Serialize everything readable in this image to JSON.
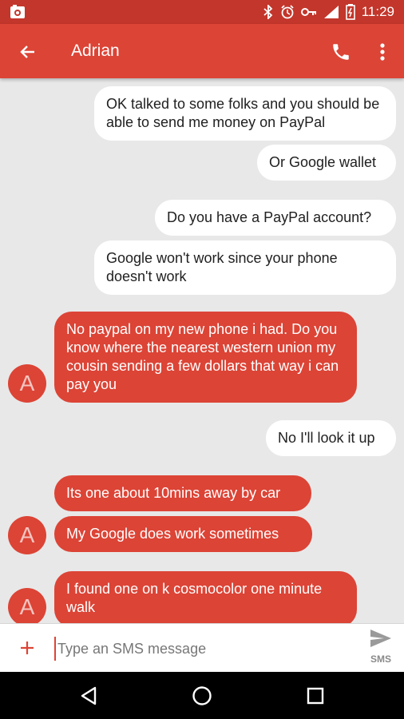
{
  "status_bar": {
    "time": "11:29",
    "icons": [
      "bluetooth-icon",
      "alarm-icon",
      "key-icon",
      "signal-icon",
      "battery-icon"
    ]
  },
  "app_bar": {
    "title": "Adrian",
    "icons": [
      "back-arrow-icon",
      "phone-icon",
      "more-vert-icon"
    ]
  },
  "conversation": {
    "avatar_initial": "A",
    "messages": [
      {
        "dir": "out",
        "text": "OK talked to some folks and you should be able to send me money on PayPal"
      },
      {
        "dir": "out",
        "text": "Or Google wallet"
      },
      {
        "dir": "out",
        "text": "Do you have a PayPal account?"
      },
      {
        "dir": "out",
        "text": "Google won't work since your phone doesn't work"
      },
      {
        "dir": "in",
        "text": "No paypal on my new phone i had. Do you know where the nearest western union my cousin sending a few dollars that way i can pay you"
      },
      {
        "dir": "out",
        "text": "No I'll look it up"
      },
      {
        "dir": "in",
        "text": "Its one about 10mins away by car"
      },
      {
        "dir": "in",
        "text": "My Google does work sometimes"
      },
      {
        "dir": "in",
        "text": "I found one on k cosmocolor one minute walk"
      }
    ]
  },
  "compose": {
    "placeholder": "Type an SMS message",
    "send_label": "SMS"
  },
  "colors": {
    "status_bar": "#c3362b",
    "app_bar": "#dc4436",
    "incoming_bubble": "#dc4436",
    "outgoing_bubble": "#ffffff",
    "background": "#e8e8e8"
  }
}
